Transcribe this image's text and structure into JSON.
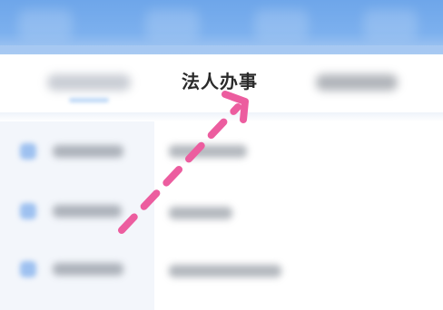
{
  "header": {
    "background": "#7cb0ee"
  },
  "tabs": {
    "active_label": "法人办事",
    "accent": "#bcd7f6"
  },
  "annotation": {
    "arrow_color": "#ec5d9f",
    "arrow_style": "dashed"
  }
}
